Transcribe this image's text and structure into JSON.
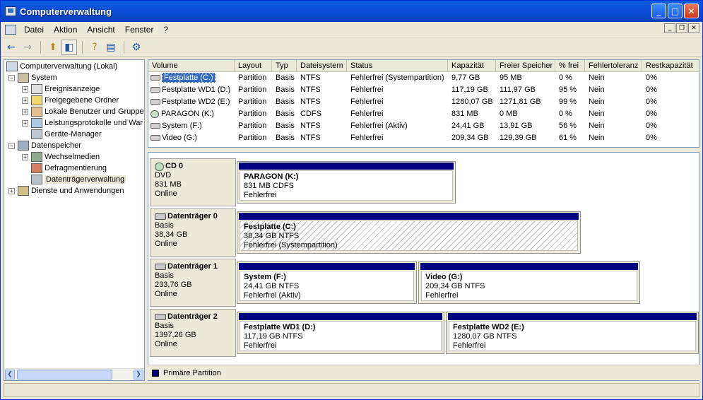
{
  "window": {
    "title": "Computerverwaltung"
  },
  "menu": [
    "Datei",
    "Aktion",
    "Ansicht",
    "Fenster",
    "?"
  ],
  "tree": [
    {
      "label": "Computerverwaltung (Lokal)",
      "level": 0,
      "expander": ""
    },
    {
      "label": "System",
      "level": 1,
      "expander": "−"
    },
    {
      "label": "Ereignisanzeige",
      "level": 2,
      "expander": "+"
    },
    {
      "label": "Freigegebene Ordner",
      "level": 2,
      "expander": "+"
    },
    {
      "label": "Lokale Benutzer und Gruppe",
      "level": 2,
      "expander": "+"
    },
    {
      "label": "Leistungsprotokolle und War",
      "level": 2,
      "expander": "+"
    },
    {
      "label": "Geräte-Manager",
      "level": 2,
      "expander": ""
    },
    {
      "label": "Datenspeicher",
      "level": 1,
      "expander": "−"
    },
    {
      "label": "Wechselmedien",
      "level": 2,
      "expander": "+"
    },
    {
      "label": "Defragmentierung",
      "level": 2,
      "expander": ""
    },
    {
      "label": "Datenträgerverwaltung",
      "level": 2,
      "expander": "",
      "selected": true
    },
    {
      "label": "Dienste und Anwendungen",
      "level": 1,
      "expander": "+"
    }
  ],
  "volumes": {
    "headers": [
      "Volume",
      "Layout",
      "Typ",
      "Dateisystem",
      "Status",
      "Kapazität",
      "Freier Speicher",
      "% frei",
      "Fehlertoleranz",
      "Restkapazität"
    ],
    "rows": [
      [
        "Festplatte (C:)",
        "Partition",
        "Basis",
        "NTFS",
        "Fehlerfrei (Systempartition)",
        "9,77 GB",
        "95 MB",
        "0 %",
        "Nein",
        "0%"
      ],
      [
        "Festplatte WD1 (D:)",
        "Partition",
        "Basis",
        "NTFS",
        "Fehlerfrei",
        "117,19 GB",
        "111,97 GB",
        "95 %",
        "Nein",
        "0%"
      ],
      [
        "Festplatte WD2 (E:)",
        "Partition",
        "Basis",
        "NTFS",
        "Fehlerfrei",
        "1280,07 GB",
        "1271,81 GB",
        "99 %",
        "Nein",
        "0%"
      ],
      [
        "PARAGON (K:)",
        "Partition",
        "Basis",
        "CDFS",
        "Fehlerfrei",
        "831 MB",
        "0 MB",
        "0 %",
        "Nein",
        "0%"
      ],
      [
        "System (F:)",
        "Partition",
        "Basis",
        "NTFS",
        "Fehlerfrei (Aktiv)",
        "24,41 GB",
        "13,91 GB",
        "56 %",
        "Nein",
        "0%"
      ],
      [
        "Video (G:)",
        "Partition",
        "Basis",
        "NTFS",
        "Fehlerfrei",
        "209,34 GB",
        "129,39 GB",
        "61 %",
        "Nein",
        "0%"
      ]
    ]
  },
  "disks": [
    {
      "name": "CD 0",
      "type": "DVD",
      "size": "831 MB",
      "state": "Online",
      "partitions": [
        {
          "name": "PARAGON  (K:)",
          "size": "831 MB CDFS",
          "status": "Fehlerfrei"
        }
      ]
    },
    {
      "name": "Datenträger 0",
      "type": "Basis",
      "size": "38,34 GB",
      "state": "Online",
      "partitions": [
        {
          "name": "Festplatte  (C:)",
          "size": "38,34 GB NTFS",
          "status": "Fehlerfrei (Systempartition)"
        }
      ]
    },
    {
      "name": "Datenträger 1",
      "type": "Basis",
      "size": "233,76 GB",
      "state": "Online",
      "partitions": [
        {
          "name": "System  (F:)",
          "size": "24,41 GB NTFS",
          "status": "Fehlerfrei (Aktiv)"
        },
        {
          "name": "Video  (G:)",
          "size": "209,34 GB NTFS",
          "status": "Fehlerfrei"
        }
      ]
    },
    {
      "name": "Datenträger 2",
      "type": "Basis",
      "size": "1397,26 GB",
      "state": "Online",
      "partitions": [
        {
          "name": "Festplatte WD1  (D:)",
          "size": "117,19 GB NTFS",
          "status": "Fehlerfrei"
        },
        {
          "name": "Festplatte WD2  (E:)",
          "size": "1280,07 GB NTFS",
          "status": "Fehlerfrei"
        }
      ]
    }
  ],
  "legend": {
    "label": "Primäre Partition",
    "color": "#000080"
  }
}
